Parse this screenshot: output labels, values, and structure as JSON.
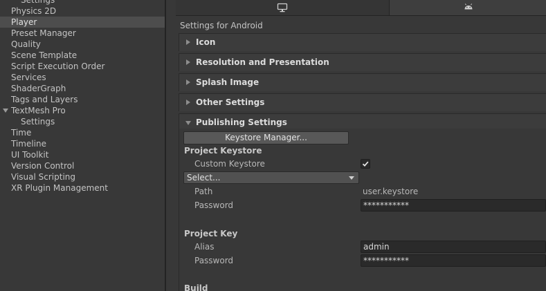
{
  "sidebar": {
    "items": [
      {
        "label": "Settings",
        "indent": 1
      },
      {
        "label": "Physics 2D",
        "indent": 0
      },
      {
        "label": "Player",
        "indent": 0,
        "selected": true
      },
      {
        "label": "Preset Manager",
        "indent": 0
      },
      {
        "label": "Quality",
        "indent": 0
      },
      {
        "label": "Scene Template",
        "indent": 0
      },
      {
        "label": "Script Execution Order",
        "indent": 0
      },
      {
        "label": "Services",
        "indent": 0
      },
      {
        "label": "ShaderGraph",
        "indent": 0
      },
      {
        "label": "Tags and Layers",
        "indent": 0
      },
      {
        "label": "TextMesh Pro",
        "indent": 0,
        "expanded": true
      },
      {
        "label": "Settings",
        "indent": 1
      },
      {
        "label": "Time",
        "indent": 0
      },
      {
        "label": "Timeline",
        "indent": 0
      },
      {
        "label": "UI Toolkit",
        "indent": 0
      },
      {
        "label": "Version Control",
        "indent": 0
      },
      {
        "label": "Visual Scripting",
        "indent": 0
      },
      {
        "label": "XR Plugin Management",
        "indent": 0
      }
    ]
  },
  "platform_tabs": [
    {
      "icon": "monitor-icon",
      "selected": false
    },
    {
      "icon": "android-icon",
      "selected": true
    }
  ],
  "settings_title": "Settings for Android",
  "foldouts": [
    {
      "label": "Icon",
      "expanded": false
    },
    {
      "label": "Resolution and Presentation",
      "expanded": false
    },
    {
      "label": "Splash Image",
      "expanded": false
    },
    {
      "label": "Other Settings",
      "expanded": false
    },
    {
      "label": "Publishing Settings",
      "expanded": true
    }
  ],
  "publishing": {
    "keystore_manager_label": "Keystore Manager...",
    "project_keystore_heading": "Project Keystore",
    "custom_keystore_label": "Custom Keystore",
    "custom_keystore_checked": true,
    "keystore_select_value": "Select...",
    "path_label": "Path",
    "path_value": "user.keystore",
    "keystore_password_label": "Password",
    "keystore_password_value": "***********",
    "project_key_heading": "Project Key",
    "alias_label": "Alias",
    "alias_value": "admin",
    "key_password_label": "Password",
    "key_password_value": "***********",
    "build_heading": "Build"
  },
  "colors": {
    "background": "#383838",
    "selected_row": "#4d4d4d",
    "field": "#2a2a2a"
  }
}
